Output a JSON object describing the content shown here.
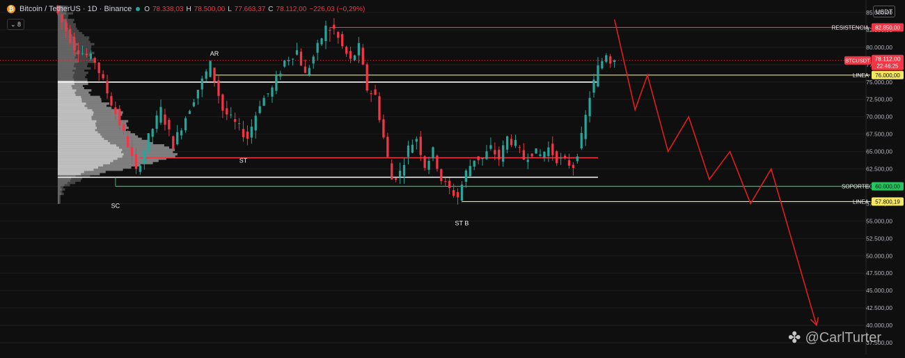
{
  "header": {
    "coin_glyph": "₿",
    "title": "Bitcoin / TetherUS · 1D · Binance",
    "ohlc": [
      {
        "k": "O",
        "v": "78.338,03"
      },
      {
        "k": "H",
        "v": "78.500,00"
      },
      {
        "k": "L",
        "v": "77.663,37"
      },
      {
        "k": "C",
        "v": "78.112,00"
      },
      {
        "k": "",
        "v": "−226,03 (−0,29%)"
      }
    ],
    "indicator_count": "8",
    "currency": "USDT"
  },
  "watermark": {
    "logo": "✤",
    "text": "@CarlTurter"
  },
  "colors": {
    "background": "#0f0f0f",
    "up": "#26a69a",
    "down": "#f23645",
    "resistance": "#f23645",
    "support": "#22c55e",
    "linea": "#f5e663",
    "white_line": "#ffffff",
    "forecast": "#e11d1d",
    "axis_text": "#b2b5be"
  },
  "chart_data": {
    "type": "candlestick",
    "title": "Bitcoin / TetherUS · 1D · Binance",
    "y_axis": {
      "min": 35800,
      "max": 86800,
      "side": "right",
      "ticks": [
        "85.000,00",
        "82.500,00",
        "80.000,00",
        "77.500,00",
        "75.000,00",
        "72.500,00",
        "70.000,00",
        "67.500,00",
        "65.000,00",
        "62.500,00",
        "60.000,00",
        "57.500,00",
        "55.000,00",
        "52.500,00",
        "50.000,00",
        "47.500,00",
        "45.000,00",
        "42.500,00",
        "40.000,00",
        "37.500,00"
      ],
      "tick_values": [
        85000,
        82500,
        80000,
        77500,
        75000,
        72500,
        70000,
        67500,
        65000,
        62500,
        60000,
        57500,
        55000,
        52500,
        50000,
        47500,
        45000,
        42500,
        40000,
        37500
      ]
    },
    "price_path": [
      [
        0,
        86000
      ],
      [
        5,
        80000
      ],
      [
        10,
        78000
      ],
      [
        14,
        72000
      ],
      [
        18,
        66000
      ],
      [
        20,
        62000
      ],
      [
        23,
        67000
      ],
      [
        26,
        71000
      ],
      [
        29,
        66000
      ],
      [
        32,
        70000
      ],
      [
        35,
        74000
      ],
      [
        38,
        77500
      ],
      [
        41,
        71000
      ],
      [
        44,
        69000
      ],
      [
        47,
        67000
      ],
      [
        50,
        72000
      ],
      [
        53,
        74000
      ],
      [
        56,
        78000
      ],
      [
        59,
        79500
      ],
      [
        61,
        76000
      ],
      [
        64,
        80000
      ],
      [
        66,
        82800
      ],
      [
        68,
        82500
      ],
      [
        70,
        80000
      ],
      [
        72,
        78000
      ],
      [
        74,
        80000
      ],
      [
        76,
        74000
      ],
      [
        78,
        73000
      ],
      [
        80,
        67000
      ],
      [
        82,
        61000
      ],
      [
        84,
        62000
      ],
      [
        86,
        65500
      ],
      [
        88,
        67000
      ],
      [
        90,
        63000
      ],
      [
        92,
        65000
      ],
      [
        94,
        61000
      ],
      [
        96,
        59500
      ],
      [
        98,
        58500
      ],
      [
        100,
        62000
      ],
      [
        102,
        64000
      ],
      [
        104,
        64000
      ],
      [
        106,
        65500
      ],
      [
        108,
        64000
      ],
      [
        110,
        67000
      ],
      [
        112,
        66000
      ],
      [
        114,
        64000
      ],
      [
        116,
        65000
      ],
      [
        118,
        64500
      ],
      [
        120,
        65500
      ],
      [
        122,
        64000
      ],
      [
        124,
        63500
      ],
      [
        126,
        63000
      ],
      [
        128,
        67000
      ],
      [
        130,
        73000
      ],
      [
        132,
        77000
      ],
      [
        134,
        79200
      ],
      [
        135,
        78112
      ]
    ],
    "levels": [
      {
        "name": "RESISTENCIA",
        "label": "RESISTENCIA",
        "value": 82850,
        "value_label": "82.850,00",
        "color": "#f23645",
        "x_start": 66
      },
      {
        "name": "LINEA",
        "label": "LINEA",
        "value": 76000,
        "value_label": "76.000,00",
        "color": "#f5e663",
        "x_start": 38
      },
      {
        "name": "SOPORTE",
        "label": "SOPORTE",
        "value": 60000,
        "value_label": "60.000,00",
        "color": "#22c55e",
        "x_start": 14
      },
      {
        "name": "LINEA",
        "label": "LINEA",
        "value": 57800.19,
        "value_label": "57.800,19",
        "color": "#f5e663",
        "x_start": 98
      }
    ],
    "range_lines": [
      {
        "value": 75000,
        "x_start": 0,
        "x_end": 131,
        "color": "#ffffff"
      },
      {
        "value": 61300,
        "x_start": 0,
        "x_end": 131,
        "color": "#ffffff"
      },
      {
        "value": 64100,
        "x_start": 20,
        "x_end": 131,
        "color": "#f23645"
      }
    ],
    "last_price": {
      "label": "BTCUSDT",
      "value": 78112,
      "value_label": "78.112,00",
      "countdown": "22:46:25"
    },
    "annotations": [
      {
        "text": "AR",
        "x": 38,
        "value": 78800
      },
      {
        "text": "ST",
        "x": 45,
        "value": 63400
      },
      {
        "text": "SC",
        "x": 14,
        "value": 56900
      },
      {
        "text": "ST B",
        "x": 98,
        "value": 54400
      }
    ],
    "forecast_path": [
      [
        135,
        84000
      ],
      [
        140,
        71000
      ],
      [
        143,
        76000
      ],
      [
        148,
        65000
      ],
      [
        153,
        70000
      ],
      [
        158,
        61000
      ],
      [
        163,
        65000
      ],
      [
        168,
        57500
      ],
      [
        173,
        62500
      ],
      [
        184,
        40000
      ]
    ],
    "x_range": [
      -14,
      196
    ]
  }
}
